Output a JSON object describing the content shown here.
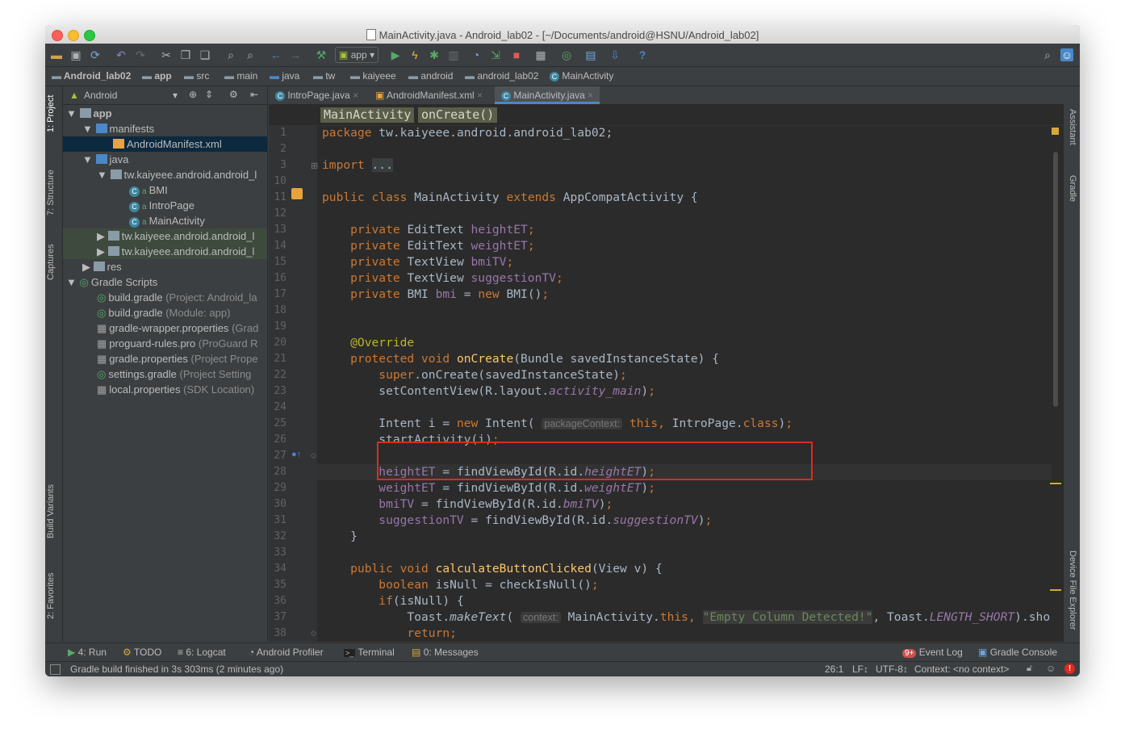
{
  "window": {
    "title": "MainActivity.java - Android_lab02 - [~/Documents/android@HSNU/Android_lab02]"
  },
  "toolbar": {
    "run_config": "app"
  },
  "navbar": {
    "crumbs": [
      "Android_lab02",
      "app",
      "src",
      "main",
      "java",
      "tw",
      "kaiyeee",
      "android",
      "android_lab02",
      "MainActivity"
    ]
  },
  "left_strip": {
    "tabs": [
      "1: Project",
      "7: Structure",
      "Captures",
      "Build Variants",
      "2: Favorites"
    ]
  },
  "right_strip": {
    "tabs": [
      "Assistant",
      "Gradle",
      "Device File Explorer"
    ]
  },
  "project": {
    "view": "Android",
    "tree": [
      {
        "label": "app",
        "extra": ""
      },
      {
        "label": "manifests",
        "extra": ""
      },
      {
        "label": "AndroidManifest.xml",
        "extra": ""
      },
      {
        "label": "java",
        "extra": ""
      },
      {
        "label": "tw.kaiyeee.android.android_l",
        "extra": ""
      },
      {
        "label": "BMI",
        "extra": ""
      },
      {
        "label": "IntroPage",
        "extra": ""
      },
      {
        "label": "MainActivity",
        "extra": ""
      },
      {
        "label": "tw.kaiyeee.android.android_l",
        "extra": ""
      },
      {
        "label": "tw.kaiyeee.android.android_l",
        "extra": ""
      },
      {
        "label": "res",
        "extra": ""
      },
      {
        "label": "Gradle Scripts",
        "extra": ""
      },
      {
        "label": "build.gradle",
        "extra": "(Project: Android_la"
      },
      {
        "label": "build.gradle",
        "extra": "(Module: app)"
      },
      {
        "label": "gradle-wrapper.properties",
        "extra": "(Grad"
      },
      {
        "label": "proguard-rules.pro",
        "extra": "(ProGuard R"
      },
      {
        "label": "gradle.properties",
        "extra": "(Project Prope"
      },
      {
        "label": "settings.gradle",
        "extra": "(Project Setting"
      },
      {
        "label": "local.properties",
        "extra": "(SDK Location)"
      }
    ]
  },
  "editor": {
    "tabs": [
      "IntroPage.java",
      "AndroidManifest.xml",
      "MainActivity.java"
    ],
    "active_tab": "MainActivity.java",
    "breadcrumb": [
      "MainActivity",
      "onCreate()"
    ],
    "line_numbers": [
      "1",
      "2",
      "3",
      "10",
      "11",
      "12",
      "13",
      "14",
      "15",
      "16",
      "17",
      "18",
      "19",
      "20",
      "21",
      "22",
      "23",
      "24",
      "25",
      "26",
      "27",
      "28",
      "29",
      "30",
      "31",
      "32",
      "33",
      "34",
      "35",
      "36",
      "37",
      "38"
    ],
    "code": {
      "l1a": "package ",
      "l1b": "tw.kaiyeee.android.android_lab02;",
      "l3a": "import ",
      "l3b": "...",
      "l11a": "public class ",
      "l11b": "MainActivity ",
      "l11c": "extends ",
      "l11d": "AppCompatActivity {",
      "l13a": "    private ",
      "l13b": "EditText ",
      "l13c": "heightET",
      "l13d": ";",
      "l14a": "    private ",
      "l14b": "EditText ",
      "l14c": "weightET",
      "l14d": ";",
      "l15a": "    private ",
      "l15b": "TextView ",
      "l15c": "bmiTV",
      "l15d": ";",
      "l16a": "    private ",
      "l16b": "TextView ",
      "l16c": "suggestionTV",
      "l16d": ";",
      "l17a": "    private ",
      "l17b": "BMI ",
      "l17c": "bmi",
      "l17d": " = ",
      "l17e": "new ",
      "l17f": "BMI()",
      "l17g": ";",
      "l20": "    @Override",
      "l21a": "    protected void ",
      "l21b": "onCreate",
      "l21c": "(Bundle savedInstanceState) {",
      "l22a": "        super",
      "l22b": ".onCreate(savedInstanceState)",
      "l22c": ";",
      "l23a": "        setContentView(R.layout.",
      "l23b": "activity_main",
      "l23c": ")",
      "l23d": ";",
      "l25a": "        Intent i = ",
      "l25b": "new ",
      "l25c": "Intent( ",
      "l25hint": "packageContext:",
      "l25d": " this, ",
      "l25e": "IntroPage.",
      "l25f": "class",
      "l25g": ")",
      "l25h": ";",
      "l26a": "        startActivity(i)",
      "l26b": ";",
      "l28a": "        heightET",
      "l28b": " = findViewById(R.id.",
      "l28c": "heightET",
      "l28d": ")",
      "l28e": ";",
      "l29a": "        weightET",
      "l29b": " = findViewById(R.id.",
      "l29c": "weightET",
      "l29d": ")",
      "l29e": ";",
      "l30a": "        bmiTV",
      "l30b": " = findViewById(R.id.",
      "l30c": "bmiTV",
      "l30d": ")",
      "l30e": ";",
      "l31a": "        suggestionTV",
      "l31b": " = findViewById(R.id.",
      "l31c": "suggestionTV",
      "l31d": ")",
      "l31e": ";",
      "l32": "    }",
      "l34a": "    public void ",
      "l34b": "calculateButtonClicked",
      "l34c": "(View v) {",
      "l35a": "        boolean ",
      "l35b": "isNull = checkIsNull()",
      "l35c": ";",
      "l36a": "        if",
      "l36b": "(isNull) {",
      "l37a": "            Toast.",
      "l37b": "makeText",
      "l37c": "( ",
      "l37hint": "context:",
      "l37d": " MainActivity.",
      "l37e": "this",
      "l37f": ", ",
      "l37g": "\"Empty Column Detected!\"",
      "l37h": ", Toast.",
      "l37i": "LENGTH_SHORT",
      "l37j": ").sho",
      "l38a": "            return",
      "l38b": ";"
    }
  },
  "bottom_tools": {
    "run": "4: Run",
    "todo": "TODO",
    "logcat": "6: Logcat",
    "profiler": "Android Profiler",
    "terminal": "Terminal",
    "messages": "0: Messages",
    "event_badge": "9+",
    "event_log": "Event Log",
    "gradle_console": "Gradle Console"
  },
  "status": {
    "message": "Gradle build finished in 3s 303ms (2 minutes ago)",
    "position": "26:1",
    "line_sep": "LF↕",
    "encoding": "UTF-8↕",
    "context": "Context: <no context>"
  },
  "colors": {
    "accent": "#4a88c7",
    "highlight_box": "#e0291f",
    "background": "#2b2b2b"
  }
}
